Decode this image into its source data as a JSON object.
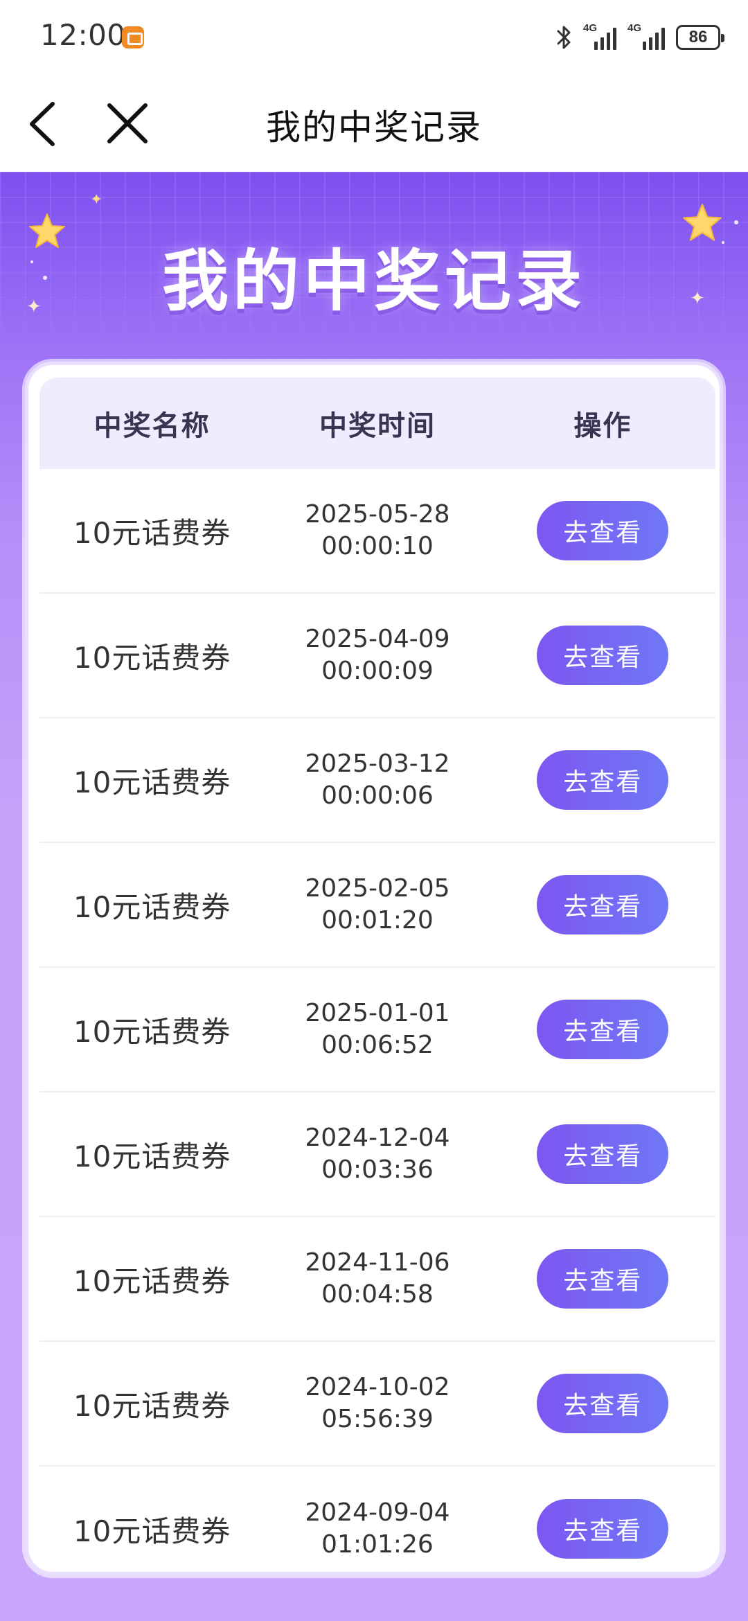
{
  "status_bar": {
    "time": "12:00",
    "network_1": "4G",
    "network_2": "4G",
    "battery": "86"
  },
  "nav": {
    "title": "我的中奖记录"
  },
  "hero": {
    "title": "我的中奖记录"
  },
  "table": {
    "headers": [
      "中奖名称",
      "中奖时间",
      "操作"
    ],
    "rows": [
      {
        "name": "10元话费券",
        "date": "2025-05-28",
        "time": "00:00:10",
        "action": "去查看"
      },
      {
        "name": "10元话费券",
        "date": "2025-04-09",
        "time": "00:00:09",
        "action": "去查看"
      },
      {
        "name": "10元话费券",
        "date": "2025-03-12",
        "time": "00:00:06",
        "action": "去查看"
      },
      {
        "name": "10元话费券",
        "date": "2025-02-05",
        "time": "00:01:20",
        "action": "去查看"
      },
      {
        "name": "10元话费券",
        "date": "2025-01-01",
        "time": "00:06:52",
        "action": "去查看"
      },
      {
        "name": "10元话费券",
        "date": "2024-12-04",
        "time": "00:03:36",
        "action": "去查看"
      },
      {
        "name": "10元话费券",
        "date": "2024-11-06",
        "time": "00:04:58",
        "action": "去查看"
      },
      {
        "name": "10元话费券",
        "date": "2024-10-02",
        "time": "05:56:39",
        "action": "去查看"
      },
      {
        "name": "10元话费券",
        "date": "2024-09-04",
        "time": "01:01:26",
        "action": "去查看"
      }
    ]
  },
  "icons": {
    "back": "back-arrow-icon",
    "close": "close-icon",
    "bluetooth": "bluetooth-icon",
    "signal": "signal-icon",
    "battery": "battery-icon",
    "app_notification": "app-notification-icon",
    "star": "star-icon",
    "sparkle": "sparkle-icon"
  },
  "colors": {
    "hero_top": "#7d4ff0",
    "hero_bottom": "#c8a6fb",
    "header_row": "#f1ebfe",
    "button_start": "#7e56f2",
    "button_end": "#6f78f5"
  }
}
